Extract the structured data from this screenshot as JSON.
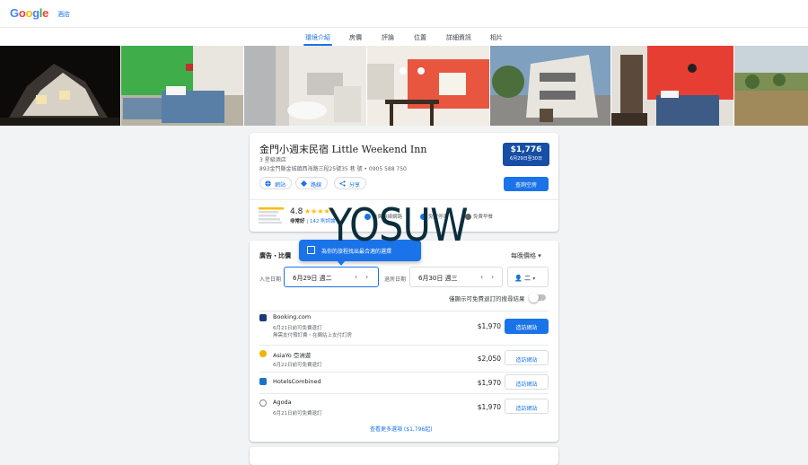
{
  "header": {
    "logo": "Google",
    "hotels_link": "酒店"
  },
  "tabs": [
    {
      "label": "環境介紹",
      "active": true
    },
    {
      "label": "房價"
    },
    {
      "label": "評論"
    },
    {
      "label": "位置"
    },
    {
      "label": "詳細資訊"
    },
    {
      "label": "相片"
    }
  ],
  "hotel": {
    "name": "金門小週末民宿 Little Weekend Inn",
    "class": "3 星級酒店",
    "address": "893金門縣金城鎮西海路三段25號35 巷 號 • 0905 588 750",
    "price": "$1,776",
    "dates": "6月29日至30日",
    "check_button": "查詢空房",
    "actions": {
      "website": "網站",
      "directions": "路線",
      "share": "分享"
    },
    "rating": "4.8",
    "rating_word": "非常好",
    "reviews_link": "142 則評論",
    "amenities": [
      "免費無線網路",
      "免費停車",
      "免費早餐"
    ],
    "amenity_partial": "免費"
  },
  "watermark": "YOSUW",
  "booking": {
    "title": "廣告・比價",
    "tooltip": "為你的旅程找出最合適的選擇",
    "sort": "每晚價格",
    "checkin_label": "入住日期",
    "checkin_value": "6月29日 週二",
    "checkout_label": "退房日期",
    "checkout_value": "6月30日 週三",
    "guests": "二",
    "toggle_label": "僅顯示可免費退訂的搜尋結果",
    "providers": [
      {
        "name": "Booking.com",
        "sub1": "6月21日前可免費退訂",
        "sub2": "無需支付預訂費・在網站上支付訂房",
        "price": "$1,970",
        "button": "造訪網站",
        "primary": true,
        "color": "#1a3a7a"
      },
      {
        "name": "AsiaYo 亞洲遊",
        "sub1": "6月22日前可免費退訂",
        "price": "$2,050",
        "button": "造訪網站",
        "color": "#f2b400"
      },
      {
        "name": "HotelsCombined",
        "price": "$1,970",
        "button": "造訪網站",
        "color": "#1a73c8"
      },
      {
        "name": "Agoda",
        "sub1": "6月21日前可免費退訂",
        "price": "$1,970",
        "button": "造訪網站",
        "color": "#888888"
      }
    ],
    "more_link": "查看更多選項 ($1,796起)"
  },
  "colors": {
    "accent": "#1a73e8",
    "price_badge": "#174ea6",
    "star": "#fbbc04"
  }
}
